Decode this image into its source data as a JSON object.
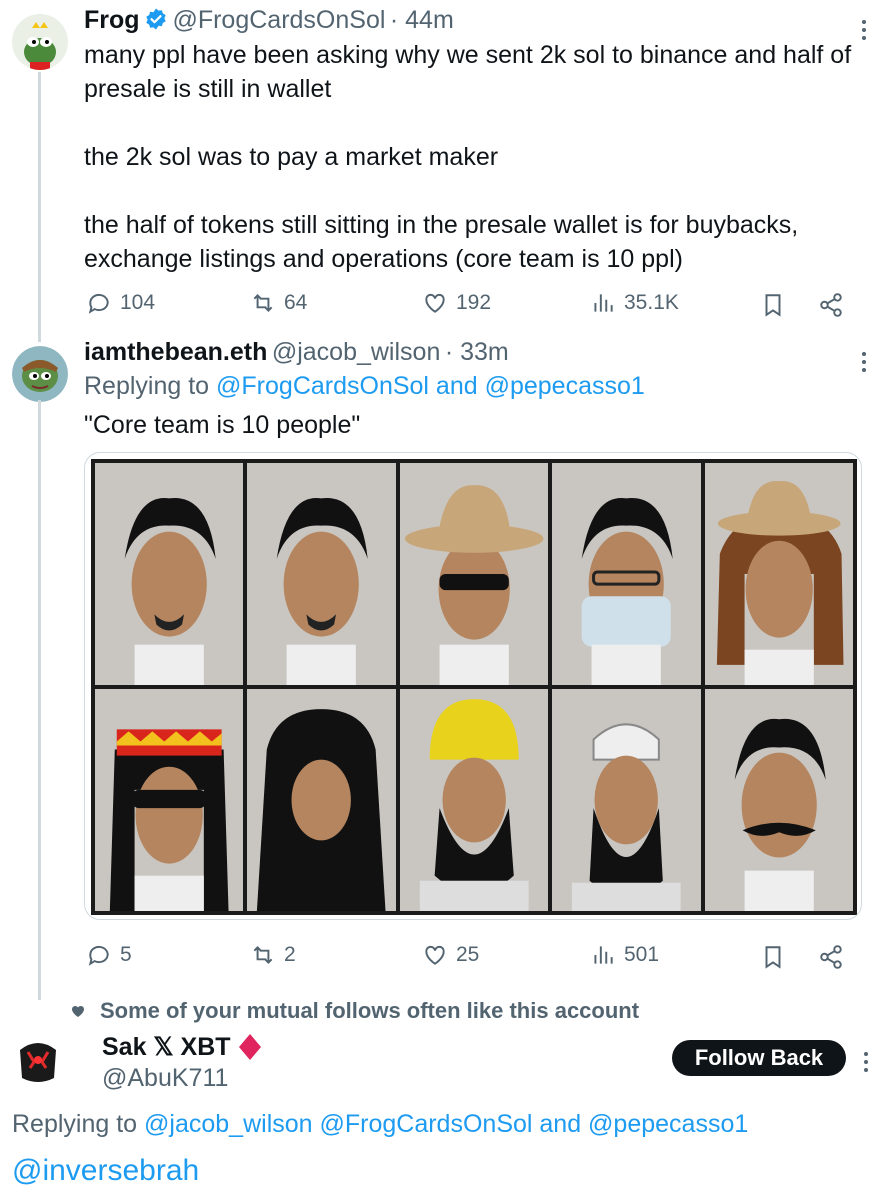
{
  "tweet1": {
    "name": "Frog",
    "handle": "@FrogCardsOnSol",
    "time": "· 44m",
    "text": "many ppl have been asking why we sent 2k sol to binance and half of presale is still in wallet\n\nthe 2k sol was to pay a market maker\n\nthe half of tokens still sitting in the presale wallet is for buybacks, exchange listings and operations (core team is 10 ppl)",
    "replies": "104",
    "reposts": "64",
    "likes": "192",
    "views": "35.1K"
  },
  "tweet2": {
    "name": "iamthebean.eth",
    "handle": "@jacob_wilson",
    "time": "· 33m",
    "replying_prefix": "Replying to",
    "replying_links": "@FrogCardsOnSol and @pepecasso1",
    "text": "\"Core team is 10 people\"",
    "replies": "5",
    "reposts": "2",
    "likes": "25",
    "views": "501"
  },
  "social_context": "Some of your mutual follows often like this account",
  "tweet3": {
    "name": "Sak 𝕏 XBT",
    "handle": "@AbuK711",
    "follow_label": "Follow Back",
    "replying_prefix": "Replying to",
    "replying_links": "@jacob_wilson @FrogCardsOnSol and @pepecasso1",
    "mention": "@inversebrah"
  },
  "colors": {
    "link": "#1d9bf0",
    "secondary_text": "#536471",
    "verified": "#1d9bf0",
    "diamond": "#e0245e",
    "thread_line": "#cfd9de"
  },
  "icons": [
    "reply-icon",
    "repost-icon",
    "like-icon",
    "views-icon",
    "bookmark-icon",
    "share-icon",
    "more-icon",
    "verified-icon",
    "diamond-icon",
    "heart-icon"
  ]
}
